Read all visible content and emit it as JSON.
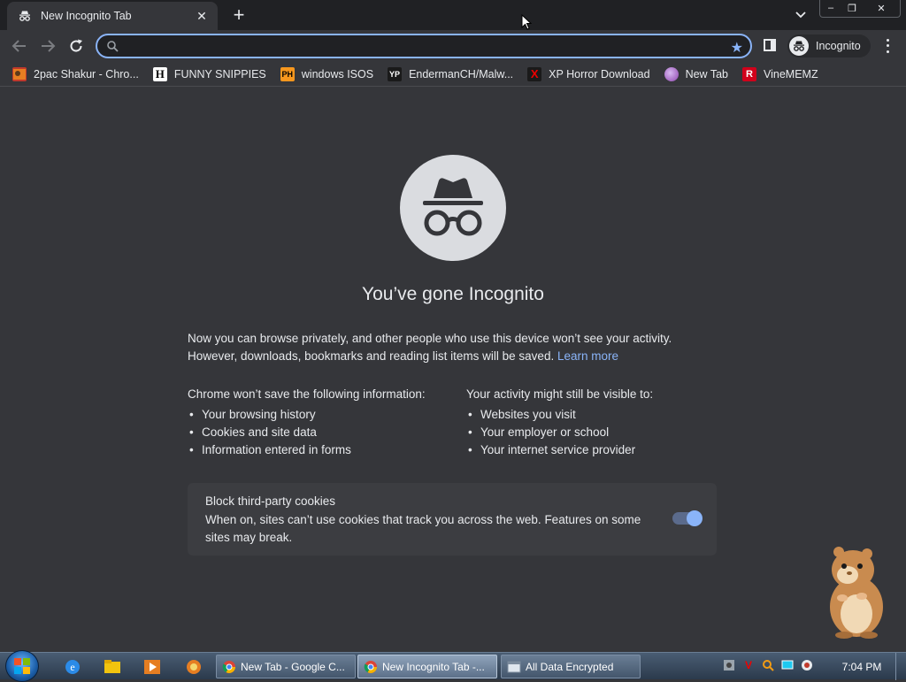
{
  "browser": {
    "tab_title": "New Incognito Tab",
    "tab_close": "✕",
    "new_tab": "+",
    "window_minimize": "–",
    "window_restore": "❐",
    "window_close": "✕",
    "omnibox_value": "",
    "profile_label": "Incognito"
  },
  "bookmarks": [
    {
      "label": "2pac Shakur - Chro...",
      "icon": "photo-icon",
      "badge": "",
      "color": "#c0392b"
    },
    {
      "label": "FUNNY SNIPPIES",
      "icon": "h-logo-icon",
      "badge": "H",
      "color": "#ffffff"
    },
    {
      "label": "windows ISOS",
      "icon": "ph-logo-icon",
      "badge": "PH",
      "color": "#f7971e"
    },
    {
      "label": "EndermanCH/Malw...",
      "icon": "yp-logo-icon",
      "badge": "YP",
      "color": "#1a1a1a"
    },
    {
      "label": "XP Horror Download",
      "icon": "x-logo-icon",
      "badge": "X",
      "color": "#cc0000"
    },
    {
      "label": "New Tab",
      "icon": "globe-icon",
      "badge": "",
      "color": "#9b59b6"
    },
    {
      "label": "VineMEMZ",
      "icon": "r-logo-icon",
      "badge": "R",
      "color": "#d0021b"
    }
  ],
  "incognito": {
    "heading": "You’ve gone Incognito",
    "intro": "Now you can browse privately, and other people who use this device won’t see your activity. However, downloads, bookmarks and reading list items will be saved.",
    "learn_more": "Learn more",
    "not_saved_title": "Chrome won’t save the following information:",
    "not_saved": [
      "Your browsing history",
      "Cookies and site data",
      "Information entered in forms"
    ],
    "visible_title": "Your activity might still be visible to:",
    "visible": [
      "Websites you visit",
      "Your employer or school",
      "Your internet service provider"
    ],
    "cookies_title": "Block third-party cookies",
    "cookies_desc": "When on, sites can’t use cookies that track you across the web. Features on some sites may break.",
    "cookies_enabled": true
  },
  "taskbar": {
    "buttons": [
      {
        "label": "New Tab - Google C...",
        "active": false
      },
      {
        "label": "New Incognito Tab -...",
        "active": true
      },
      {
        "label": "All Data Encrypted",
        "active": false
      }
    ],
    "clock": "7:04 PM"
  },
  "colors": {
    "accent": "#8ab4f8",
    "page_bg": "#35363a",
    "tab_strip_bg": "#202124"
  }
}
